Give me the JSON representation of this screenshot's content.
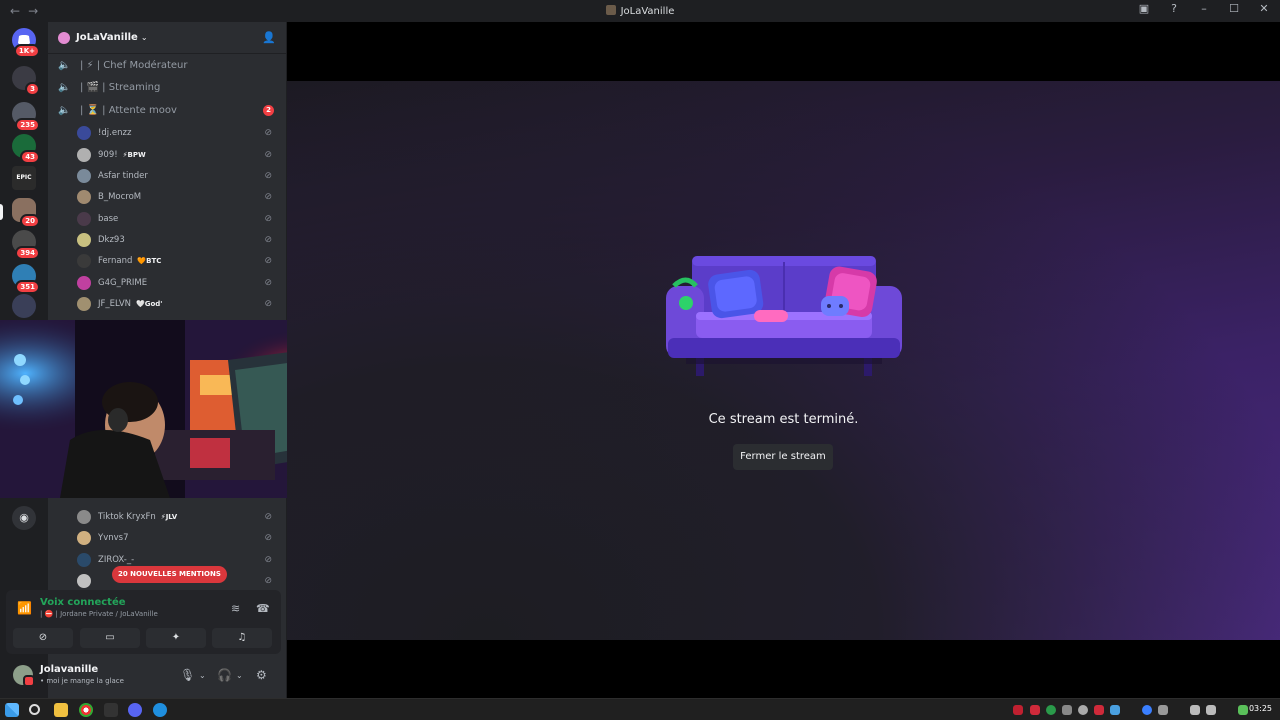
{
  "window": {
    "title": "JoLaVanille",
    "back_glyph": "←",
    "forward_glyph": "→"
  },
  "rail": {
    "home_badge": "1K+",
    "servers": [
      {
        "badge": "3"
      },
      {
        "badge": "235"
      },
      {
        "badge": "43"
      },
      {
        "label": "EPIC"
      },
      {
        "badge": "20"
      },
      {
        "badge": "394"
      },
      {
        "badge": "351"
      }
    ]
  },
  "guild": {
    "name": "JoLaVanille"
  },
  "channels": [
    {
      "name": "| ⚡ | Chef Modérateur"
    },
    {
      "name": "| 🎬 | Streaming"
    },
    {
      "name": "| ⏳ | Attente moov",
      "count": "2"
    }
  ],
  "members": [
    {
      "name": "!dj.enzz",
      "tag": "",
      "color": "#3a4a9a"
    },
    {
      "name": "909!",
      "tag": "⚡BPW",
      "color": "#b0b0b0"
    },
    {
      "name": "Asfar tinder",
      "tag": "",
      "color": "#7a8a9a"
    },
    {
      "name": "B_MocroM",
      "tag": "",
      "color": "#a08a70"
    },
    {
      "name": "base",
      "tag": "",
      "color": "#4a3a4a"
    },
    {
      "name": "Dkz93",
      "tag": "",
      "color": "#c8c080"
    },
    {
      "name": "Fernand",
      "tag": "🧡BTC",
      "color": "#3a3a3a"
    },
    {
      "name": "G4G_PRIME",
      "tag": "",
      "color": "#c040a0"
    },
    {
      "name": "JF_ELVN",
      "tag": "🤍God'",
      "color": "#a09070"
    },
    {
      "name": "Tiktok KryxFn",
      "tag": "⚡JLV",
      "color": "#8a8a8a"
    },
    {
      "name": "Yvnvs7",
      "tag": "",
      "color": "#d0b080"
    },
    {
      "name": "ZIROX-_-",
      "tag": "",
      "color": "#2a4a6a"
    },
    {
      "name": "",
      "tag": "",
      "color": "#c0c0c0"
    }
  ],
  "mentions_label": "20 NOUVELLES MENTIONS",
  "voice": {
    "status": "Voix connectée",
    "location": "| ⛔ | Jordane Private / JoLaVanille"
  },
  "user": {
    "name": "Jolavanille",
    "status": "• moi je mange la glace"
  },
  "stage": {
    "ended_text": "Ce stream est terminé.",
    "close_label": "Fermer le stream"
  },
  "taskbar": {
    "time": "03:25"
  },
  "colors": {
    "accent_green": "#23a55a",
    "danger_red": "#f23f43",
    "couch_purple": "#7b4dff"
  }
}
